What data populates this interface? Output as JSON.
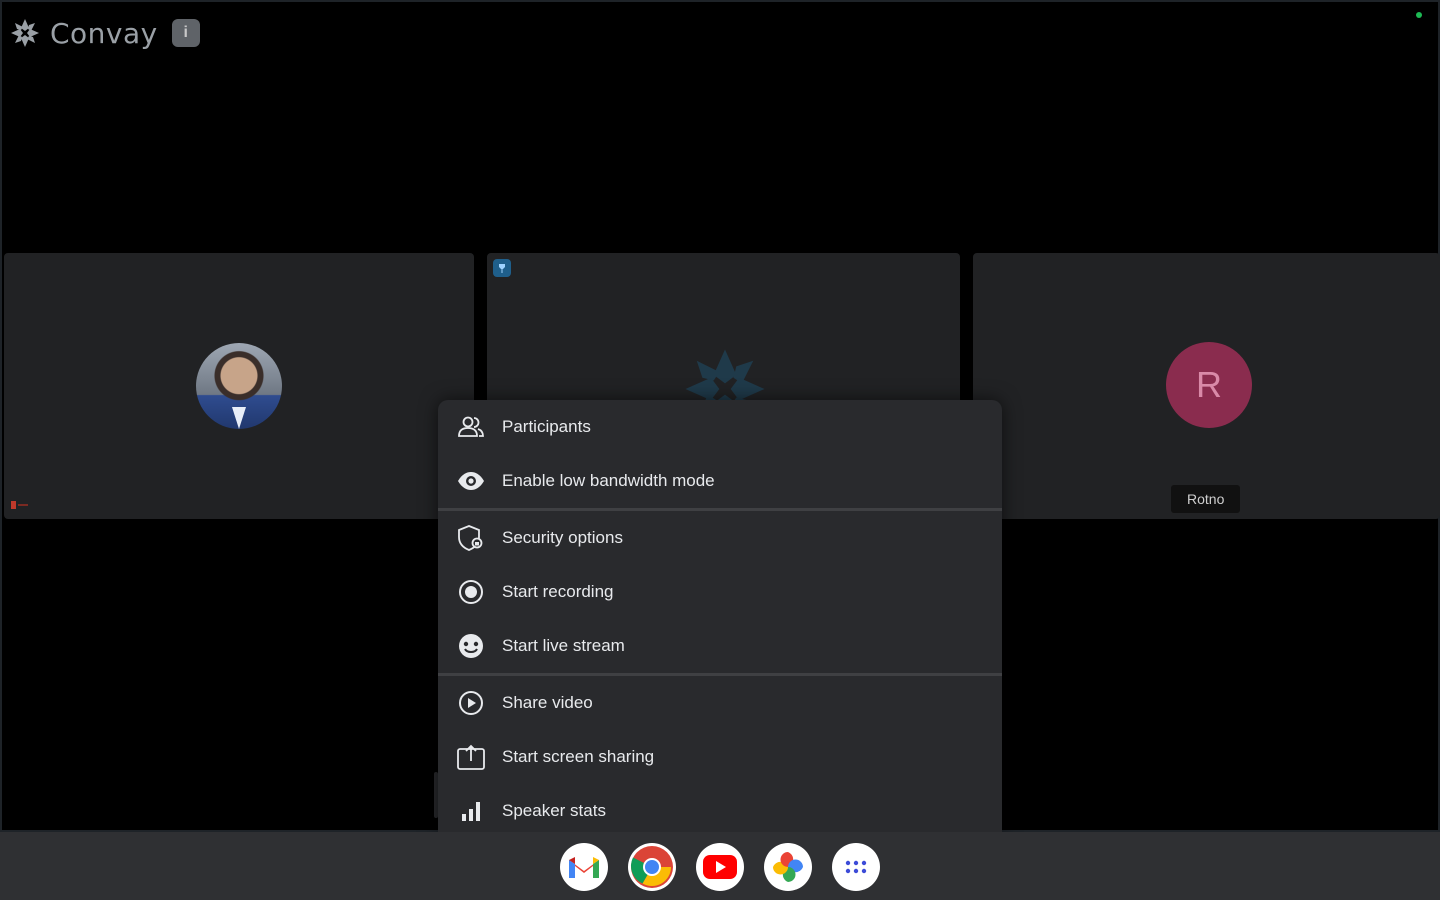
{
  "app": {
    "name": "Convay",
    "badge": "i"
  },
  "tiles": [
    {
      "id": "self",
      "muted_label": ""
    },
    {
      "id": "presenter",
      "pin_label": ""
    },
    {
      "id": "guest",
      "avatar_letter": "R",
      "name": "Rotno"
    }
  ],
  "menu": {
    "groups": [
      [
        {
          "icon": "participants-icon",
          "label": "Participants"
        },
        {
          "icon": "eye-icon",
          "label": "Enable low bandwidth mode"
        }
      ],
      [
        {
          "icon": "shield-icon",
          "label": "Security options"
        },
        {
          "icon": "record-icon",
          "label": "Start recording"
        },
        {
          "icon": "live-stream-icon",
          "label": "Start live stream"
        }
      ],
      [
        {
          "icon": "play-circle-icon",
          "label": "Share video"
        },
        {
          "icon": "screen-share-icon",
          "label": "Start screen sharing"
        },
        {
          "icon": "bar-chart-icon",
          "label": "Speaker stats"
        }
      ]
    ]
  },
  "shelf": {
    "apps": [
      {
        "icon": "gmail-icon"
      },
      {
        "icon": "chrome-icon"
      },
      {
        "icon": "youtube-icon"
      },
      {
        "icon": "photos-icon"
      },
      {
        "icon": "app-launcher-icon"
      }
    ]
  }
}
